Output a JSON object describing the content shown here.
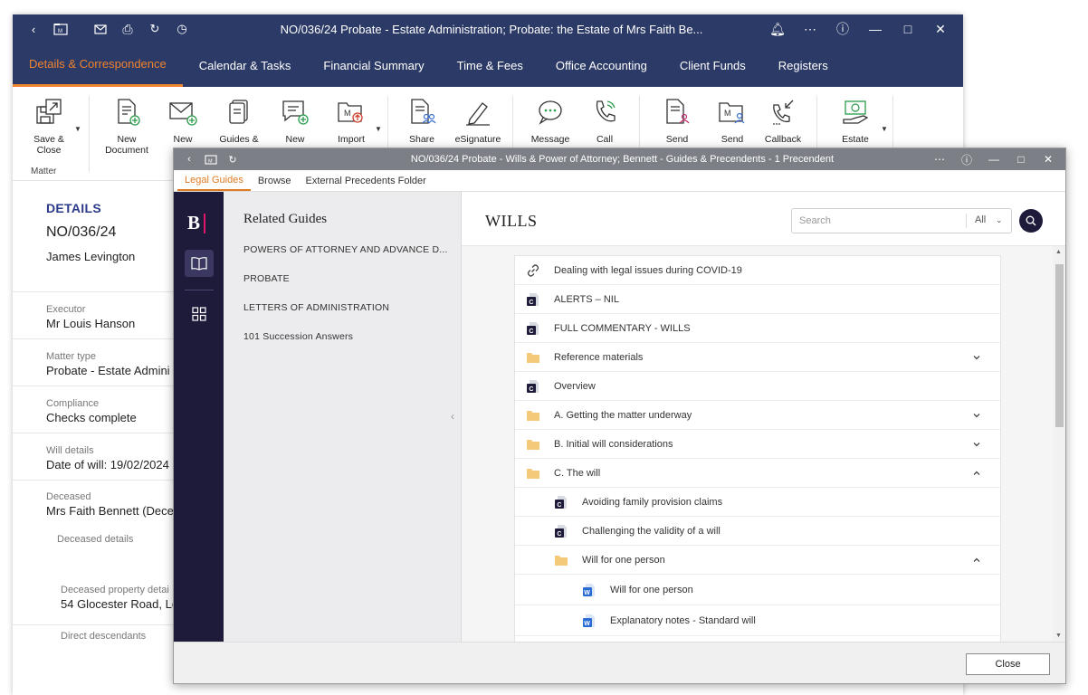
{
  "back_window": {
    "title": "NO/036/24 Probate - Estate Administration; Probate: the Estate of Mrs Faith Be...",
    "nav_tabs": [
      {
        "label": "Details & Correspondence"
      },
      {
        "label": "Calendar & Tasks"
      },
      {
        "label": "Financial Summary"
      },
      {
        "label": "Time & Fees"
      },
      {
        "label": "Office Accounting"
      },
      {
        "label": "Client Funds"
      },
      {
        "label": "Registers"
      }
    ],
    "ribbon": {
      "group_label": "Matter",
      "buttons": [
        {
          "label": "Save &\nClose"
        },
        {
          "label": "New\nDocument"
        },
        {
          "label": "New"
        },
        {
          "label": "Guides &"
        },
        {
          "label": "New"
        },
        {
          "label": "Import"
        },
        {
          "label": "Share"
        },
        {
          "label": "eSignature"
        },
        {
          "label": "Message"
        },
        {
          "label": "Call"
        },
        {
          "label": "Send"
        },
        {
          "label": "Send"
        },
        {
          "label": "Callback"
        },
        {
          "label": "Estate"
        }
      ]
    },
    "details": {
      "heading": "DETAILS",
      "matter_ref": "NO/036/24",
      "client_name": "James Levington",
      "fields": [
        {
          "label": "Executor",
          "value": "Mr Louis Hanson"
        },
        {
          "label": "Matter type",
          "value": "Probate - Estate  Admini"
        },
        {
          "label": "Compliance",
          "value": "Checks complete"
        },
        {
          "label": "Will details",
          "value": "Date of will: 19/02/2024"
        },
        {
          "label": "Deceased",
          "value": "Mrs Faith Bennett (Dece"
        },
        {
          "label": "Deceased details",
          "value": ""
        },
        {
          "label": "Deceased property detai",
          "value": "54 Glocester Road, Lo"
        },
        {
          "label": "Direct descendants",
          "value": ""
        }
      ]
    }
  },
  "modal": {
    "title": "NO/036/24 Probate - Wills & Power of Attorney; Bennett - Guides & Precendents - 1 Precendent",
    "tabs": [
      {
        "label": "Legal Guides"
      },
      {
        "label": "Browse"
      },
      {
        "label": "External Precedents Folder"
      }
    ],
    "rail_logo": "B",
    "related": {
      "title": "Related Guides",
      "items": [
        {
          "label": "POWERS OF ATTORNEY AND ADVANCE D..."
        },
        {
          "label": "PROBATE"
        },
        {
          "label": "LETTERS OF ADMINISTRATION"
        },
        {
          "label": "101 Succession Answers"
        }
      ]
    },
    "content": {
      "title": "WILLS",
      "search": {
        "placeholder": "Search",
        "filter": "All"
      },
      "rows": [
        {
          "label": "Dealing with legal issues during COVID-19",
          "icon": "link-icon",
          "indent": 0,
          "chevron": ""
        },
        {
          "label": "ALERTS – NIL",
          "icon": "commentary-icon",
          "indent": 0,
          "chevron": ""
        },
        {
          "label": "FULL COMMENTARY - WILLS",
          "icon": "commentary-icon",
          "indent": 0,
          "chevron": ""
        },
        {
          "label": "Reference materials",
          "icon": "folder-icon",
          "indent": 0,
          "chevron": "down"
        },
        {
          "label": "Overview",
          "icon": "commentary-icon",
          "indent": 0,
          "chevron": ""
        },
        {
          "label": "A. Getting the matter underway",
          "icon": "folder-icon",
          "indent": 0,
          "chevron": "down"
        },
        {
          "label": "B. Initial will considerations",
          "icon": "folder-icon",
          "indent": 0,
          "chevron": "down"
        },
        {
          "label": "C. The will",
          "icon": "folder-icon",
          "indent": 0,
          "chevron": "up"
        },
        {
          "label": "Avoiding family provision claims",
          "icon": "commentary-icon",
          "indent": 1,
          "chevron": ""
        },
        {
          "label": "Challenging the validity of a will",
          "icon": "commentary-icon",
          "indent": 1,
          "chevron": ""
        },
        {
          "label": "Will for one person",
          "icon": "folder-icon",
          "indent": 1,
          "chevron": "up"
        },
        {
          "label": "Will for one person",
          "icon": "word-doc-icon",
          "indent": 2,
          "chevron": ""
        },
        {
          "label": "Explanatory notes - Standard will",
          "icon": "word-doc-icon",
          "indent": 2,
          "chevron": ""
        }
      ]
    },
    "close_label": "Close"
  },
  "colors": {
    "navy": "#2b3a66",
    "accent_orange": "#f0832f",
    "rail_dark": "#1d1a3a",
    "logo_pink": "#e0186c",
    "folder_yellow": "#f5c97a",
    "word_blue": "#2b6cd4"
  }
}
